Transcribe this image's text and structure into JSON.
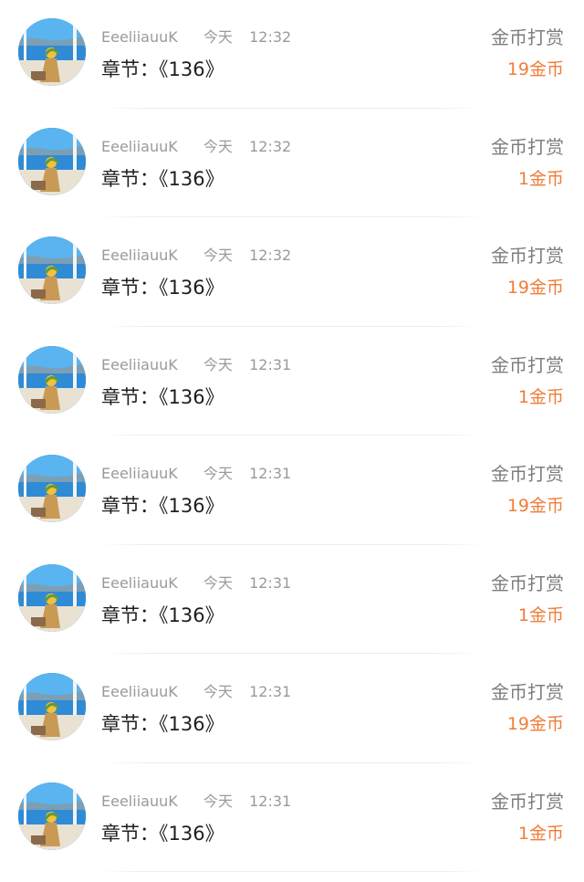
{
  "colors": {
    "accent_amount": "#ef7d3a",
    "meta_text": "#9a9a9a",
    "chapter_text": "#1e1e1e",
    "gift_label": "#7d7d7d"
  },
  "rows": [
    {
      "user": "EeeliiauuK",
      "day": "今天",
      "time": "12:32",
      "chapter": "章节：《136》",
      "gift_label": "金币打赏",
      "amount": "19金币"
    },
    {
      "user": "EeeliiauuK",
      "day": "今天",
      "time": "12:32",
      "chapter": "章节：《136》",
      "gift_label": "金币打赏",
      "amount": "1金币"
    },
    {
      "user": "EeeliiauuK",
      "day": "今天",
      "time": "12:32",
      "chapter": "章节：《136》",
      "gift_label": "金币打赏",
      "amount": "19金币"
    },
    {
      "user": "EeeliiauuK",
      "day": "今天",
      "time": "12:31",
      "chapter": "章节：《136》",
      "gift_label": "金币打赏",
      "amount": "1金币"
    },
    {
      "user": "EeeliiauuK",
      "day": "今天",
      "time": "12:31",
      "chapter": "章节：《136》",
      "gift_label": "金币打赏",
      "amount": "19金币"
    },
    {
      "user": "EeeliiauuK",
      "day": "今天",
      "time": "12:31",
      "chapter": "章节：《136》",
      "gift_label": "金币打赏",
      "amount": "1金币"
    },
    {
      "user": "EeeliiauuK",
      "day": "今天",
      "time": "12:31",
      "chapter": "章节：《136》",
      "gift_label": "金币打赏",
      "amount": "19金币"
    },
    {
      "user": "EeeliiauuK",
      "day": "今天",
      "time": "12:31",
      "chapter": "章节：《136》",
      "gift_label": "金币打赏",
      "amount": "1金币"
    }
  ]
}
